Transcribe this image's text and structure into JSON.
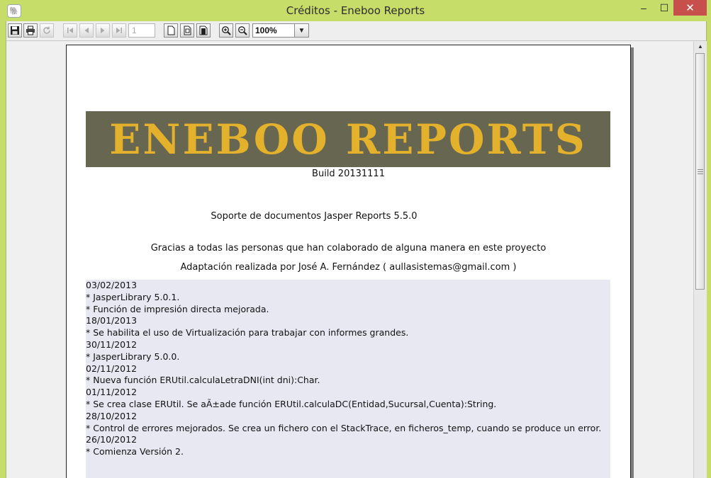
{
  "window": {
    "title": "Créditos - Eneboo Reports",
    "minimize_label": "–",
    "maximize_label": "☐",
    "close_label": "✕"
  },
  "toolbar": {
    "page_number": "1",
    "zoom": "100%"
  },
  "report": {
    "banner_title": "ENEBOO REPORTS",
    "build": "Build 20131111",
    "support": "Soporte de documentos Jasper Reports 5.5.0",
    "thanks": "Gracias a todas las personas que han colaborado de alguna manera en este proyecto",
    "adaptation": "Adaptación realizada por José A. Fernández ( aullasistemas@gmail.com )",
    "changelog": [
      "03/02/2013",
      "* JasperLibrary 5.0.1.",
      "* Función de impresión directa mejorada.",
      "18/01/2013",
      "* Se habilita el uso de Virtualización para trabajar con informes grandes.",
      "30/11/2012",
      "* JasperLibrary 5.0.0.",
      "02/11/2012",
      "* Nueva función ERUtil.calculaLetraDNI(int dni):Char.",
      "01/11/2012",
      "* Se crea clase ERUtil. Se aÃ±ade función ERUtil.calculaDC(Entidad,Sucursal,Cuenta):String.",
      "28/10/2012",
      "* Control de errores mejorados. Se crea un fichero con el StackTrace, en ficheros_temp, cuando se produce un error.",
      "26/10/2012",
      "* Comienza Versión 2."
    ]
  },
  "colors": {
    "window_frame": "#c6dd6a",
    "banner_bg": "#676650",
    "banner_text": "#e4b12c",
    "changelog_bg": "#e8e8f2"
  }
}
